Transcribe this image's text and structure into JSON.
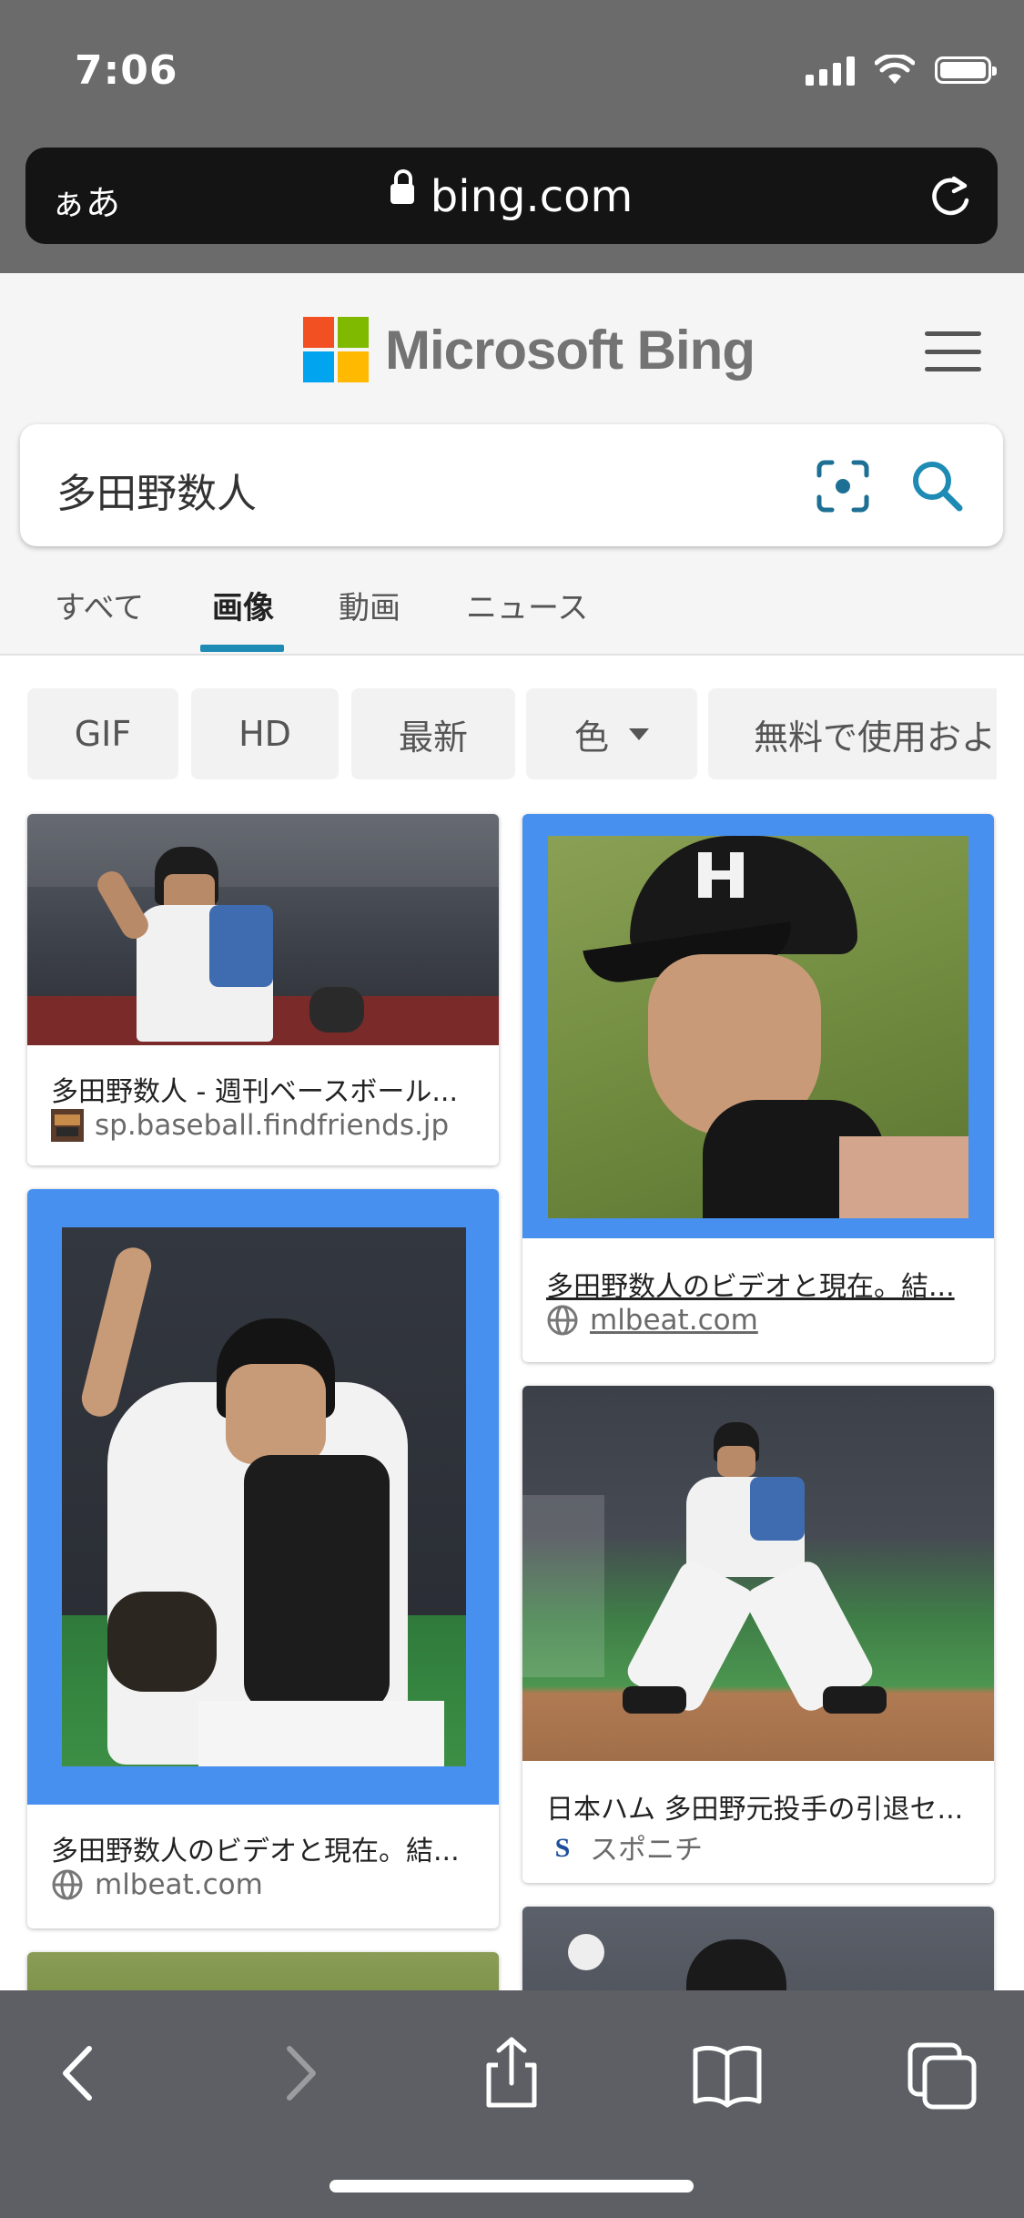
{
  "status_bar": {
    "time": "7:06"
  },
  "browser": {
    "reader_button": "ぁあ",
    "url": "bing.com"
  },
  "bing": {
    "logo_text": "Microsoft Bing",
    "search_query": "多田野数人",
    "tabs": [
      {
        "label": "すべて",
        "active": false
      },
      {
        "label": "画像",
        "active": true
      },
      {
        "label": "動画",
        "active": false
      },
      {
        "label": "ニュース",
        "active": false
      }
    ],
    "filters": [
      {
        "label": "GIF"
      },
      {
        "label": "HD"
      },
      {
        "label": "最新"
      },
      {
        "label": "色",
        "dropdown": true
      },
      {
        "label": "無料で使用およ"
      }
    ]
  },
  "results": [
    {
      "caption": "多田野数人 - 週刊ベースボール...",
      "source": "sp.baseball.findfriends.jp",
      "source_icon": "site-thumbnail-icon",
      "caption_underlined": false
    },
    {
      "caption": "多田野数人のビデオと現在。結...",
      "source": "mlbeat.com",
      "source_icon": "globe-icon",
      "caption_underlined": true
    },
    {
      "caption": "多田野数人のビデオと現在。結...",
      "source": "mlbeat.com",
      "source_icon": "globe-icon",
      "caption_underlined": false
    },
    {
      "caption": "日本ハム 多田野元投手の引退セ...",
      "source": "スポニチ",
      "source_icon": "sponichi-logo-icon",
      "caption_underlined": false
    }
  ],
  "colors": {
    "accent": "#1e8bb5",
    "frame_blue": "#4790ef",
    "ms_red": "#f25022",
    "ms_green": "#7fba00",
    "ms_blue": "#00a4ef",
    "ms_yellow": "#ffb900"
  },
  "toolbar_icons": [
    "back-icon",
    "forward-icon",
    "share-icon",
    "bookmarks-icon",
    "tabs-icon"
  ]
}
